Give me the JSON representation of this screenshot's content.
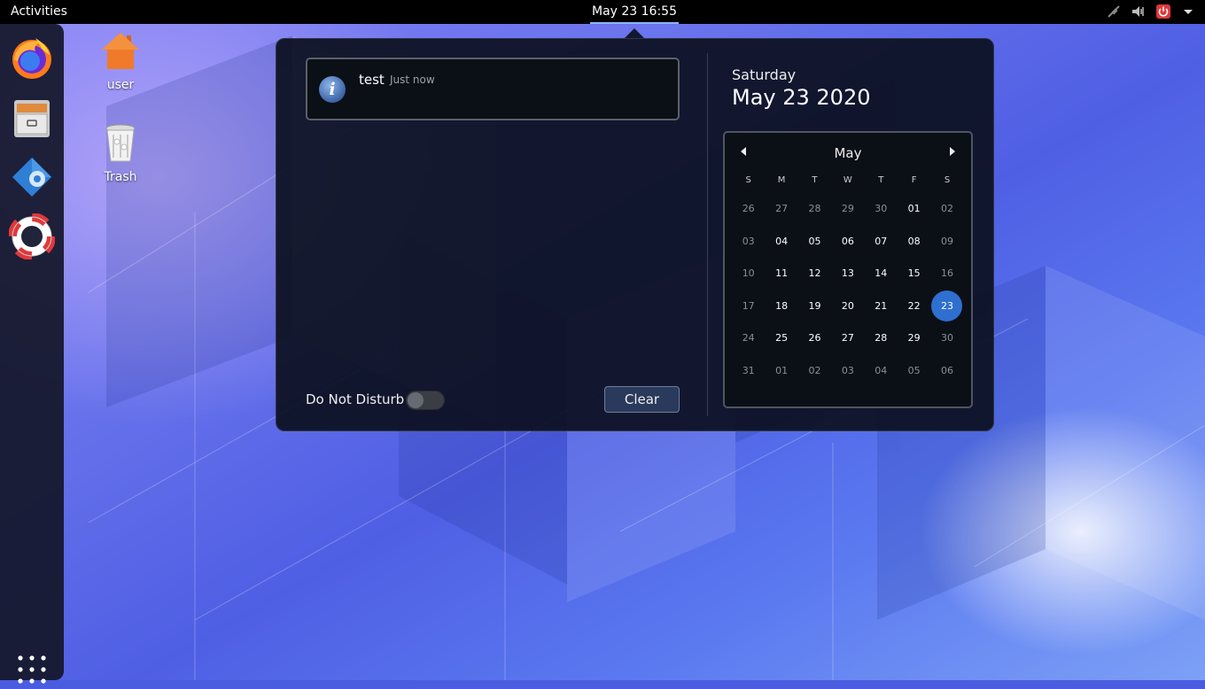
{
  "topbar": {
    "activities": "Activities",
    "clock": "May 23  16:55"
  },
  "dock": {
    "items": [
      "firefox",
      "files",
      "software-updater",
      "help"
    ]
  },
  "desktop": {
    "icons": [
      {
        "label": "user",
        "icon": "home-folder-icon"
      },
      {
        "label": "Trash",
        "icon": "trash-icon"
      }
    ]
  },
  "notifications": {
    "items": [
      {
        "title": "test",
        "time": "Just now",
        "icon": "info-icon"
      }
    ],
    "dnd_label": "Do Not Disturb",
    "dnd_enabled": false,
    "clear_label": "Clear"
  },
  "calendar": {
    "day_name": "Saturday",
    "full_date": "May 23 2020",
    "month": "May",
    "weekdays": [
      "S",
      "M",
      "T",
      "W",
      "T",
      "F",
      "S"
    ],
    "weeks": [
      [
        "26",
        "27",
        "28",
        "29",
        "30",
        "01",
        "02"
      ],
      [
        "03",
        "04",
        "05",
        "06",
        "07",
        "08",
        "09"
      ],
      [
        "10",
        "11",
        "12",
        "13",
        "14",
        "15",
        "16"
      ],
      [
        "17",
        "18",
        "19",
        "20",
        "21",
        "22",
        "23"
      ],
      [
        "24",
        "25",
        "26",
        "27",
        "28",
        "29",
        "30"
      ],
      [
        "31",
        "01",
        "02",
        "03",
        "04",
        "05",
        "06"
      ]
    ],
    "today": "23",
    "accent_color": "#2e6fd0"
  }
}
